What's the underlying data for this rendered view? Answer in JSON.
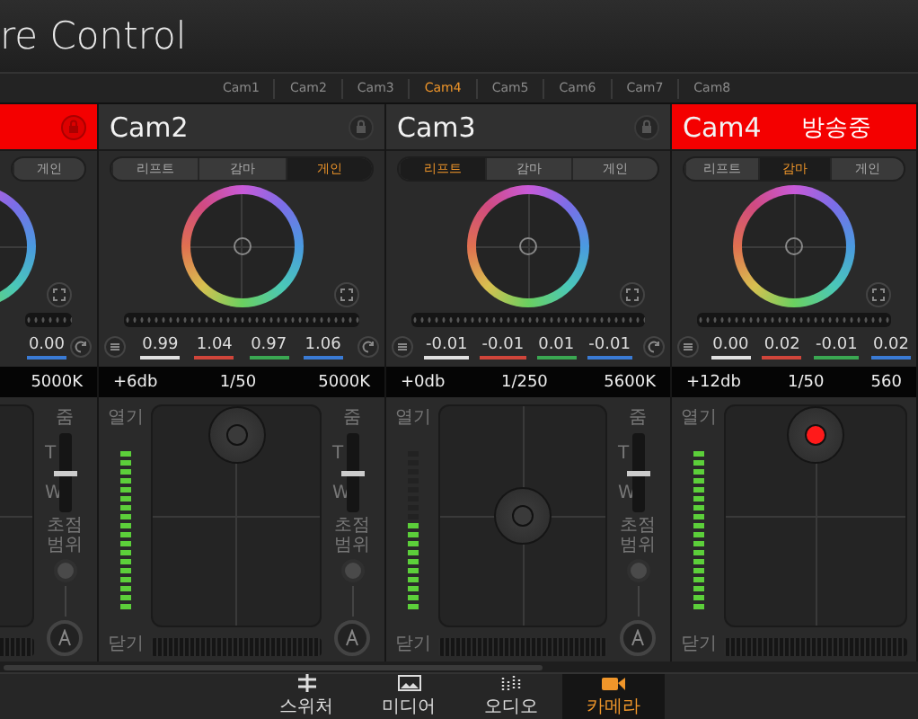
{
  "title": "re Control",
  "cam_tabs": [
    {
      "label": "Cam1",
      "selected": false
    },
    {
      "label": "Cam2",
      "selected": false
    },
    {
      "label": "Cam3",
      "selected": false
    },
    {
      "label": "Cam4",
      "selected": true
    },
    {
      "label": "Cam5",
      "selected": false
    },
    {
      "label": "Cam6",
      "selected": false
    },
    {
      "label": "Cam7",
      "selected": false
    },
    {
      "label": "Cam8",
      "selected": false
    }
  ],
  "panels": [
    {
      "kind": "left_cut",
      "on_air": true,
      "segments": [
        {
          "label": "게인",
          "selected": false
        }
      ],
      "values": [
        {
          "text": "0.00",
          "color": "#3a7bd5"
        }
      ],
      "info": [
        "5000K"
      ],
      "zoom": {
        "label": "줌",
        "tele": "T",
        "wide": "W",
        "focus_label": "초점 범위",
        "level": 0.5
      }
    },
    {
      "kind": "full",
      "name": "Cam2",
      "on_air": false,
      "segments": [
        {
          "label": "리프트",
          "selected": false
        },
        {
          "label": "감마",
          "selected": false
        },
        {
          "label": "게인",
          "selected": true
        }
      ],
      "values": [
        {
          "text": "0.99",
          "color": "#e0e0e0"
        },
        {
          "text": "1.04",
          "color": "#d0453a"
        },
        {
          "text": "0.97",
          "color": "#3aa852"
        },
        {
          "text": "1.06",
          "color": "#3a7bd5"
        }
      ],
      "info": [
        "+6db",
        "1/50",
        "5000K"
      ],
      "meter": {
        "open": "열기",
        "close": "닫기",
        "level": 1
      },
      "joystick": {
        "raised": true
      },
      "zoom": {
        "label": "줌",
        "tele": "T",
        "wide": "W",
        "focus_label": "초점 범위",
        "level": 0.5
      }
    },
    {
      "kind": "full",
      "name": "Cam3",
      "on_air": false,
      "segments": [
        {
          "label": "리프트",
          "selected": true
        },
        {
          "label": "감마",
          "selected": false
        },
        {
          "label": "게인",
          "selected": false
        }
      ],
      "values": [
        {
          "text": "-0.01",
          "color": "#e0e0e0"
        },
        {
          "text": "-0.01",
          "color": "#d0453a"
        },
        {
          "text": "0.01",
          "color": "#3aa852"
        },
        {
          "text": "-0.01",
          "color": "#3a7bd5"
        }
      ],
      "info": [
        "+0db",
        "1/250",
        "5600K"
      ],
      "meter": {
        "open": "열기",
        "close": "닫기",
        "level": 0.55
      },
      "joystick": {
        "raised": false
      },
      "zoom": {
        "label": "줌",
        "tele": "T",
        "wide": "W",
        "focus_label": "초점 범위",
        "level": 0.5
      }
    },
    {
      "kind": "right_cut",
      "name": "Cam4",
      "on_air": true,
      "on_air_label": "방송중",
      "segments": [
        {
          "label": "리프트",
          "selected": false
        },
        {
          "label": "감마",
          "selected": true
        },
        {
          "label": "게인",
          "selected": false
        }
      ],
      "values": [
        {
          "text": "0.00",
          "color": "#e0e0e0"
        },
        {
          "text": "0.02",
          "color": "#d0453a"
        },
        {
          "text": "-0.01",
          "color": "#3aa852"
        },
        {
          "text": "0.02",
          "color": "#3a7bd5"
        }
      ],
      "info": [
        "+12db",
        "1/50",
        "560"
      ],
      "meter": {
        "open": "열기",
        "close": "닫기",
        "level": 1
      },
      "joystick": {
        "raised": true
      }
    }
  ],
  "nav": [
    {
      "label": "스위처",
      "selected": false
    },
    {
      "label": "미디어",
      "selected": false
    },
    {
      "label": "오디오",
      "selected": false
    },
    {
      "label": "카메라",
      "selected": true
    }
  ]
}
